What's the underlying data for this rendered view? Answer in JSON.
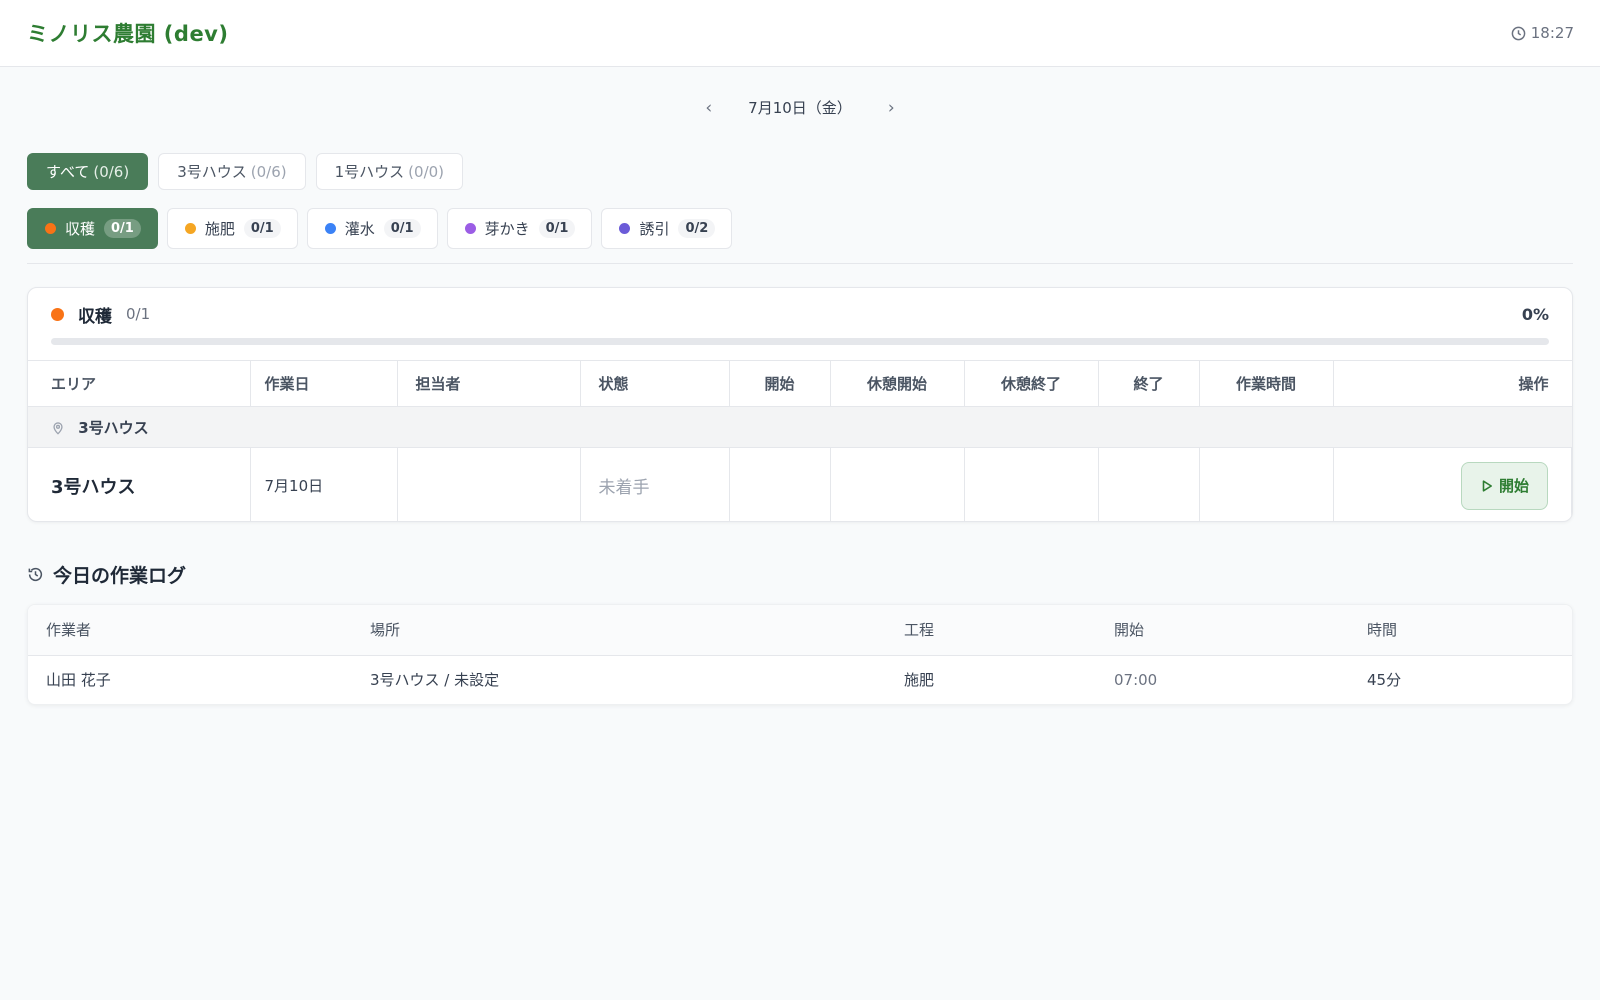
{
  "app": {
    "title": "ミノリス農園 (dev)",
    "time": "18:27"
  },
  "date_nav": {
    "prev": "‹",
    "date": "7月10日（金）",
    "next": "›"
  },
  "house_tabs": [
    {
      "label": "すべて",
      "count": "(0/6)",
      "active": true
    },
    {
      "label": "3号ハウス",
      "count": "(0/6)",
      "active": false
    },
    {
      "label": "1号ハウス",
      "count": "(0/0)",
      "active": false
    }
  ],
  "task_tabs": [
    {
      "label": "収穫",
      "count": "0/1",
      "color": "#f97316",
      "active": true
    },
    {
      "label": "施肥",
      "count": "0/1",
      "color": "#f5a623",
      "active": false
    },
    {
      "label": "灌水",
      "count": "0/1",
      "color": "#3b82f6",
      "active": false
    },
    {
      "label": "芽かき",
      "count": "0/1",
      "color": "#9b5de5",
      "active": false
    },
    {
      "label": "誘引",
      "count": "0/2",
      "color": "#6b5bd8",
      "active": false
    }
  ],
  "task_card": {
    "title": "収穫",
    "count": "0/1",
    "percent": "0%",
    "progress_fraction": 0,
    "dot_color": "#f97316",
    "columns": [
      "エリア",
      "作業日",
      "担当者",
      "状態",
      "開始",
      "休憩開始",
      "休憩終了",
      "終了",
      "作業時間",
      "操作"
    ],
    "group": "3号ハウス",
    "rows": [
      {
        "area": "3号ハウス",
        "date": "7月10日",
        "assignee": "",
        "status": "未着手",
        "start": "",
        "break_start": "",
        "break_end": "",
        "end": "",
        "duration": "",
        "action": "開始"
      }
    ]
  },
  "work_log": {
    "title": "今日の作業ログ",
    "columns": [
      "作業者",
      "場所",
      "工程",
      "開始",
      "時間"
    ],
    "rows": [
      {
        "worker": "山田 花子",
        "place": "3号ハウス / 未設定",
        "process": "施肥",
        "start": "07:00",
        "time": "45分"
      }
    ]
  },
  "colors": {
    "primary": "#4a7c59",
    "title_green": "#2e7d32"
  }
}
